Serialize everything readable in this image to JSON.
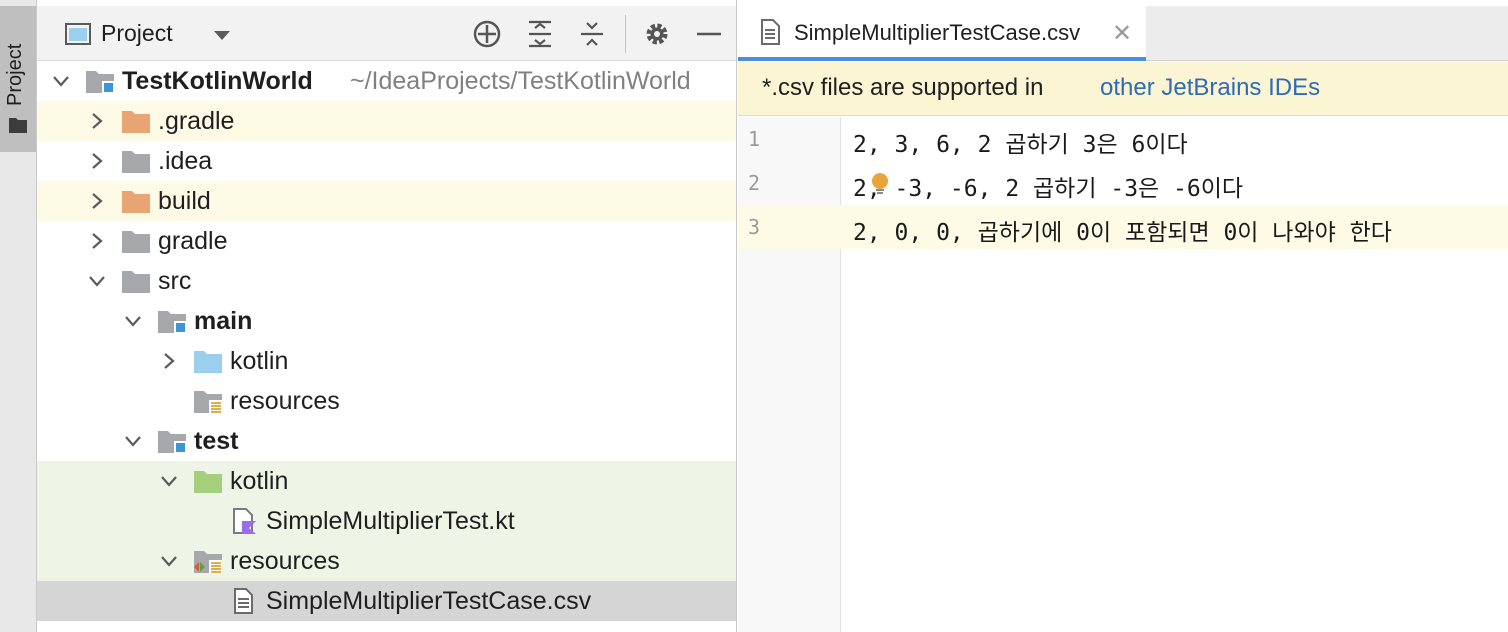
{
  "tool_strip": {
    "tab_label": "Project"
  },
  "project_panel": {
    "title": "Project",
    "toolbar": [
      "crosshair-icon",
      "expand-all-icon",
      "collapse-all-icon",
      "gear-icon",
      "minimize-icon"
    ],
    "tree": [
      {
        "label": "TestKotlinWorld",
        "path": "~/IdeaProjects/TestKotlinWorld",
        "depth": 0,
        "expanded": true,
        "icon": "module-folder-icon",
        "bold": true
      },
      {
        "label": ".gradle",
        "depth": 1,
        "expanded": false,
        "icon": "excluded-folder-icon"
      },
      {
        "label": ".idea",
        "depth": 1,
        "expanded": false,
        "icon": "folder-icon"
      },
      {
        "label": "build",
        "depth": 1,
        "expanded": false,
        "icon": "excluded-folder-icon"
      },
      {
        "label": "gradle",
        "depth": 1,
        "expanded": false,
        "icon": "folder-icon"
      },
      {
        "label": "src",
        "depth": 1,
        "expanded": true,
        "icon": "folder-icon"
      },
      {
        "label": "main",
        "depth": 2,
        "expanded": true,
        "icon": "module-folder-icon",
        "bold": true
      },
      {
        "label": "kotlin",
        "depth": 3,
        "expanded": false,
        "icon": "source-folder-icon"
      },
      {
        "label": "resources",
        "depth": 3,
        "icon": "resources-folder-icon"
      },
      {
        "label": "test",
        "depth": 2,
        "expanded": true,
        "icon": "module-folder-icon",
        "bold": true
      },
      {
        "label": "kotlin",
        "depth": 3,
        "expanded": true,
        "icon": "test-source-folder-icon"
      },
      {
        "label": "SimpleMultiplierTest.kt",
        "depth": 4,
        "icon": "kotlin-file-icon"
      },
      {
        "label": "resources",
        "depth": 3,
        "expanded": true,
        "icon": "test-resources-folder-icon"
      },
      {
        "label": "SimpleMultiplierTestCase.csv",
        "depth": 4,
        "icon": "text-file-icon"
      }
    ]
  },
  "editor": {
    "tab_name": "SimpleMultiplierTestCase.csv",
    "banner_text": "*.csv files are supported in",
    "banner_link": "other JetBrains IDEs",
    "lines": [
      {
        "num": "1",
        "code": "2, 3, 6, 2 곱하기 3은 6이다"
      },
      {
        "num": "2",
        "code": "2, -3, -6, 2 곱하기 -3은 -6이다"
      },
      {
        "num": "3",
        "code": "2, 0, 0, 곱하기에 0이 포함되면 0이 나와야 한다"
      }
    ]
  },
  "colors": {
    "accent": "#4a8fd9",
    "link": "#2d6bb6",
    "excluded": "#e8a473",
    "source": "#9ccfee",
    "test": "#a4d07e"
  }
}
